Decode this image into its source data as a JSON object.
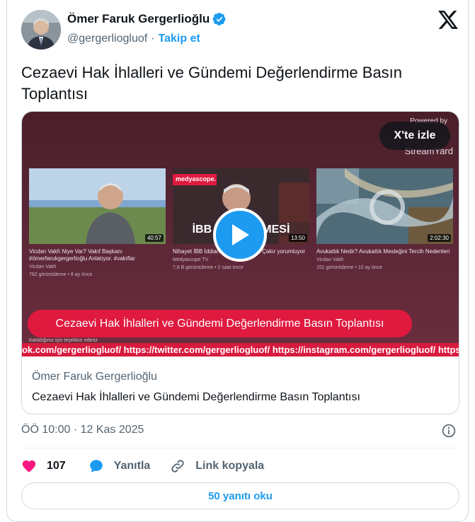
{
  "author": {
    "name": "Ömer Faruk Gergerlioğlu",
    "handle": "@gergerliogluof",
    "separator": "·",
    "follow_label": "Takip et"
  },
  "tweet": {
    "text": "Cezaevi Hak İhlalleri ve Gündemi Değerlendirme Basın Toplantısı",
    "timestamp": "ÖÖ 10:00 · 12 Kas 2025"
  },
  "media": {
    "watch_label": "X'te izle",
    "powered_by": "Powered by",
    "streamyard": "StreamYard",
    "thumbnails": [
      {
        "duration": "40:57",
        "title": "Vicdan Vakfı Niye Var? Vakıf Başkanı #ömerfarukgergerlioğlu Anlatıyor. #vakıflar",
        "channel": "Vicdan Vakfı",
        "stats": "762 görüntüleme • 8 ay önce"
      },
      {
        "duration": "13:50",
        "badge": "medyascope.",
        "overlay": "İBB İDDİANAMESİ",
        "title": "Nihayet İBB İddianamesi... | Ruşen Çakır yorumluyor",
        "channel": "Medyascope TV",
        "stats": "7,6 B görüntüleme • 2 saat önce"
      },
      {
        "duration": "2:02:30",
        "title": "Avukatlık Nedir? Avukatlık Mesleğini Tercih Nedenleri",
        "channel": "Vicdan Vakfı",
        "stats": "151 görüntüleme • 10 ay önce"
      }
    ],
    "banner": "Cezaevi Hak İhlalleri ve Gündemi Değerlendirme Basın Toplantısı",
    "thanks_text": "Katıldığınız için teşekkür ederiz",
    "ticker": "ook.com/gergerliogluof/ https://twitter.com/gergerliogluof/ https://instagram.com/gergerliogluof/ https://"
  },
  "link_card": {
    "domain": "Ömer Faruk Gergerlioğlu",
    "title": "Cezaevi Hak İhlalleri ve Gündemi Değerlendirme Basın Toplantısı"
  },
  "actions": {
    "likes": "107",
    "reply_label": "Yanıtla",
    "copy_link_label": "Link kopyala"
  },
  "read_replies_label": "50 yanıtı oku",
  "colors": {
    "accent": "#1d9bf0",
    "like": "#f91880",
    "banner": "#e0193f"
  }
}
